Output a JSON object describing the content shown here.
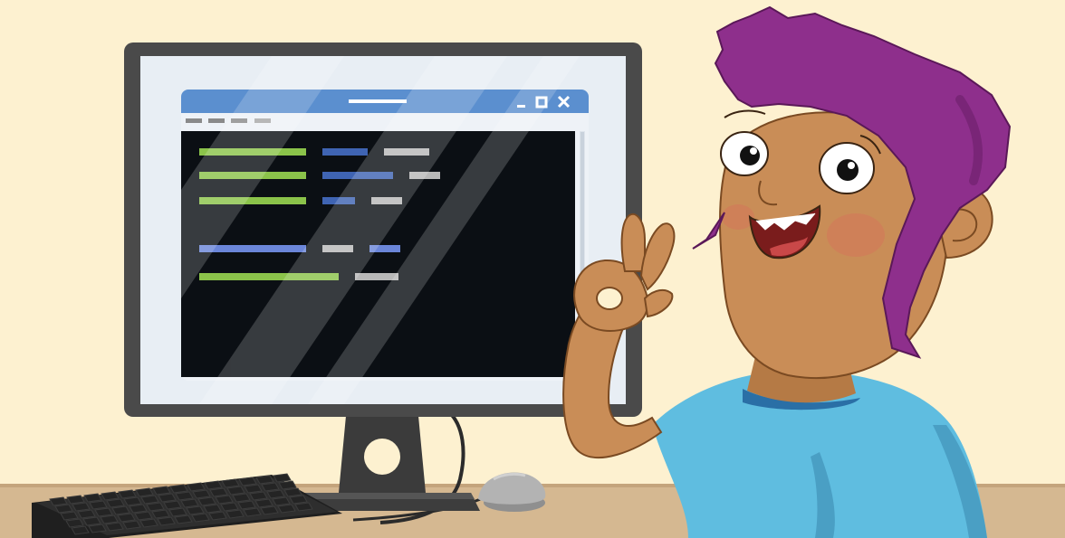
{
  "scene": {
    "description_free": true
  },
  "colors": {
    "background": "#fdf1d0",
    "desk": "#d5b891",
    "monitor_frame": "#4a4a4a",
    "screen": "#e8eef4",
    "window_titlebar": "#5b8fcf",
    "terminal_bg": "#0b0f14",
    "code_green": "#8bc34a",
    "code_blue": "#3f64b3",
    "code_gray": "#b8b8b8",
    "code_light_blue": "#6b86d9",
    "hair": "#8e2f8c",
    "skin": "#c98d57",
    "shirt": "#5fbde0",
    "keyboard": "#2b2b2b",
    "mouse": "#b3b3b3"
  },
  "window": {
    "controls": [
      "minimize-icon",
      "maximize-icon",
      "close-icon"
    ]
  },
  "terminal": {
    "lines": [
      [
        {
          "color": "green",
          "w": 118
        },
        {
          "color": "blue",
          "w": 50
        },
        {
          "color": "gray",
          "w": 50
        }
      ],
      [
        {
          "color": "green",
          "w": 118
        },
        {
          "color": "blue",
          "w": 78
        },
        {
          "color": "gray",
          "w": 34
        }
      ],
      [
        {
          "color": "green",
          "w": 118
        },
        {
          "color": "blue",
          "w": 36
        },
        {
          "color": "gray",
          "w": 34
        }
      ],
      [
        {
          "color": "light_blue",
          "w": 118
        },
        {
          "color": "gray",
          "w": 34
        },
        {
          "color": "light_blue",
          "w": 34
        }
      ],
      [
        {
          "color": "green",
          "w": 154
        },
        {
          "color": "gray",
          "w": 48
        }
      ]
    ]
  }
}
